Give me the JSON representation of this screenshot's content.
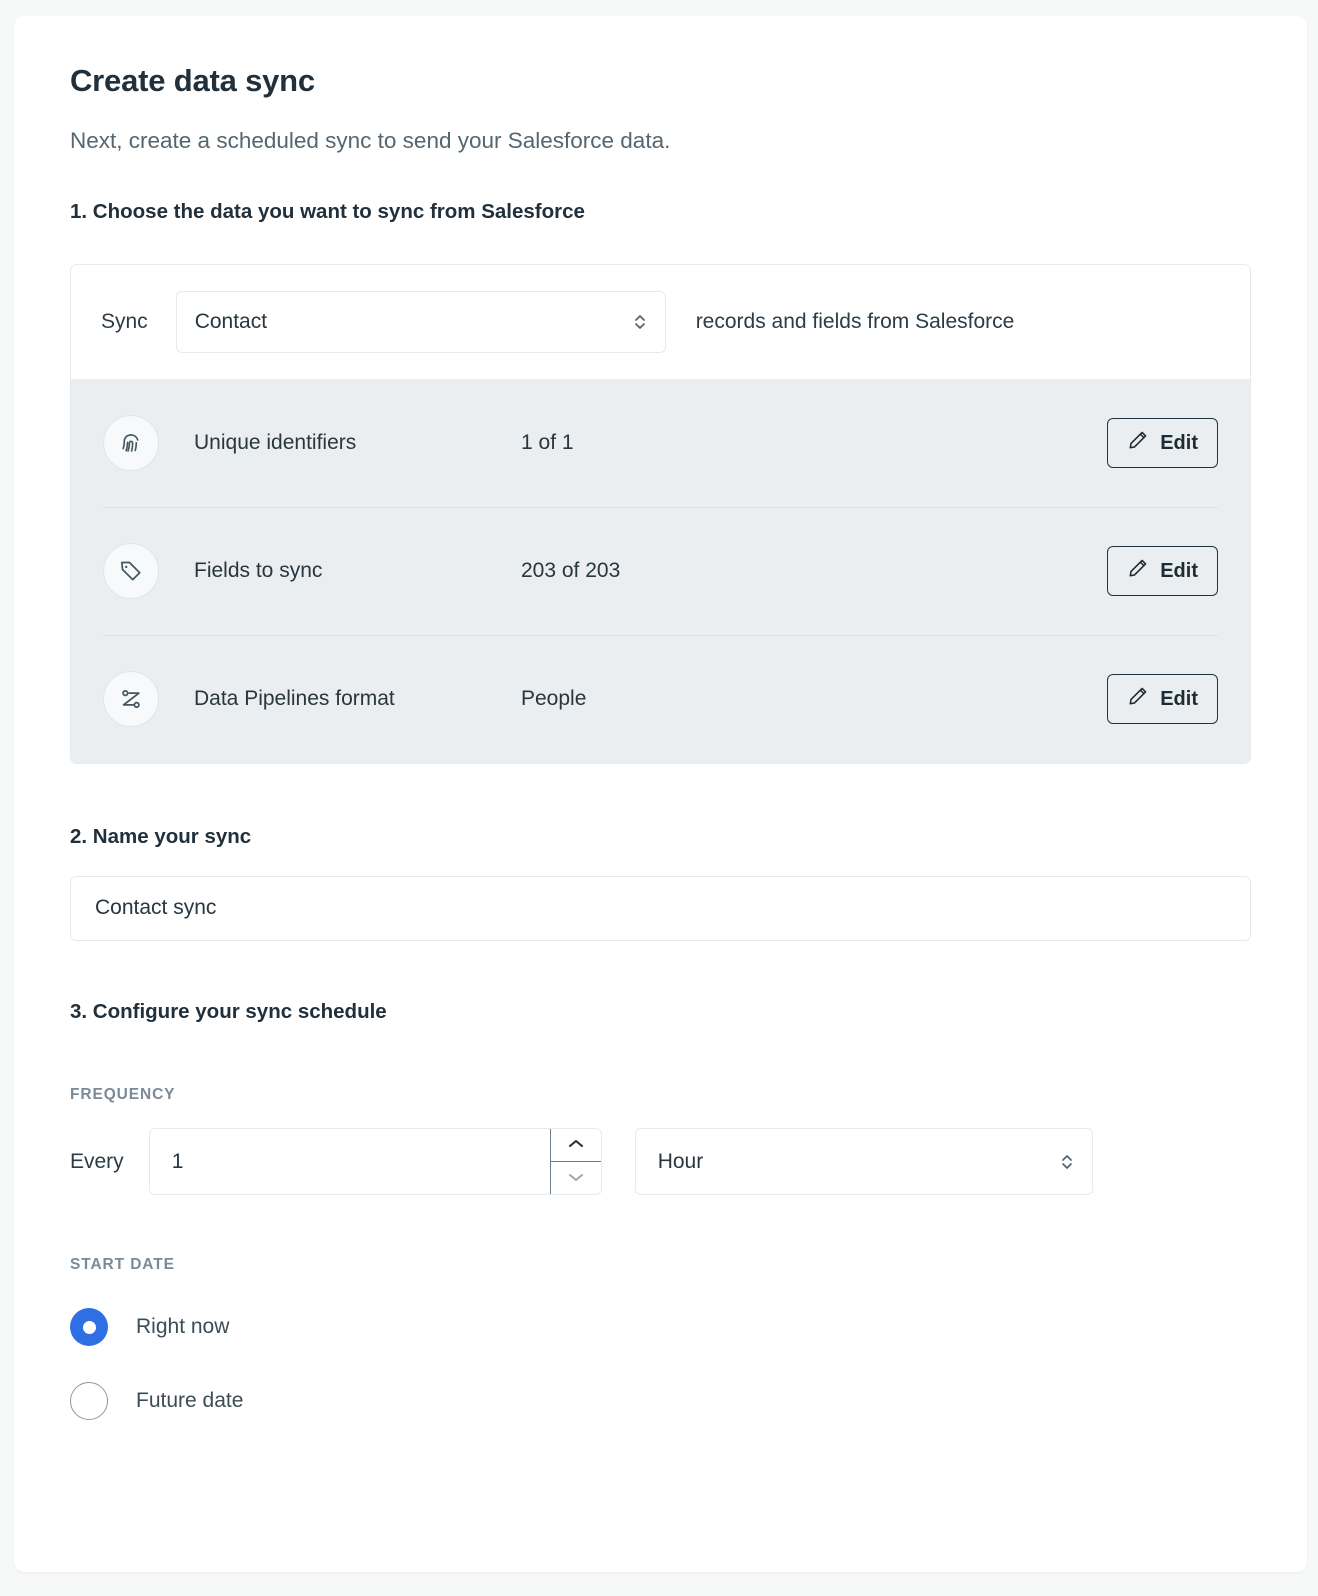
{
  "page": {
    "title": "Create data sync",
    "subtitle": "Next, create a scheduled sync to send your Salesforce data."
  },
  "step1": {
    "heading": "1. Choose the data you want to sync from Salesforce",
    "sync_prefix": "Sync",
    "object_select_value": "Contact",
    "sync_suffix": "records and fields from Salesforce",
    "rows": [
      {
        "icon": "fingerprint-icon",
        "label": "Unique identifiers",
        "value": "1 of 1",
        "edit_label": "Edit"
      },
      {
        "icon": "tag-icon",
        "label": "Fields to sync",
        "value": "203 of 203",
        "edit_label": "Edit"
      },
      {
        "icon": "data-pipelines-icon",
        "label": "Data Pipelines format",
        "value": "People",
        "edit_label": "Edit"
      }
    ]
  },
  "step2": {
    "heading": "2. Name your sync",
    "name_value": "Contact sync",
    "name_placeholder": "Contact sync"
  },
  "step3": {
    "heading": "3. Configure your sync schedule",
    "frequency_label": "FREQUENCY",
    "every_label": "Every",
    "interval_value": "1",
    "unit_value": "Hour",
    "start_date_label": "START DATE",
    "options": [
      {
        "label": "Right now",
        "selected": true
      },
      {
        "label": "Future date",
        "selected": false
      }
    ]
  },
  "colors": {
    "accent_blue": "#2f6fe4",
    "panel_grey": "#eaeef0",
    "text_dark": "#21303b",
    "text_muted": "#56666f",
    "label_muted": "#7b8a96",
    "border": "#e6eaec",
    "button_border": "#22333d"
  }
}
